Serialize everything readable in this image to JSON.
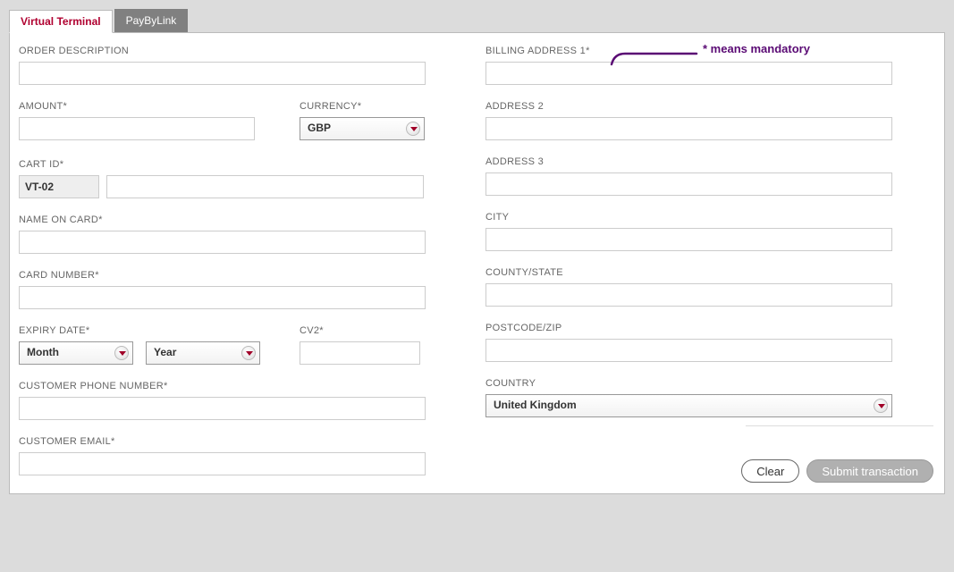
{
  "tabs": {
    "active": "Virtual Terminal",
    "other": "PayByLink"
  },
  "callout": "* means mandatory",
  "left": {
    "order_description": {
      "label": "ORDER DESCRIPTION",
      "value": ""
    },
    "amount": {
      "label": "AMOUNT*",
      "value": ""
    },
    "currency": {
      "label": "CURRENCY*",
      "value": "GBP"
    },
    "cart_id": {
      "label": "CART ID*",
      "prefix": "VT-02",
      "value": ""
    },
    "name_on_card": {
      "label": "NAME ON CARD*",
      "value": ""
    },
    "card_number": {
      "label": "CARD NUMBER*",
      "value": ""
    },
    "expiry": {
      "label": "EXPIRY DATE*",
      "month": "Month",
      "year": "Year"
    },
    "cv2": {
      "label": "CV2*",
      "value": ""
    },
    "phone": {
      "label": "CUSTOMER PHONE NUMBER*",
      "value": ""
    },
    "email": {
      "label": "CUSTOMER EMAIL*",
      "value": ""
    }
  },
  "right": {
    "billing1": {
      "label": "BILLING ADDRESS 1*",
      "value": ""
    },
    "address2": {
      "label": "ADDRESS 2",
      "value": ""
    },
    "address3": {
      "label": "ADDRESS 3",
      "value": ""
    },
    "city": {
      "label": "CITY",
      "value": ""
    },
    "county": {
      "label": "COUNTY/STATE",
      "value": ""
    },
    "postcode": {
      "label": "POSTCODE/ZIP",
      "value": ""
    },
    "country": {
      "label": "COUNTRY",
      "value": "United Kingdom"
    }
  },
  "buttons": {
    "clear": "Clear",
    "submit": "Submit transaction"
  }
}
